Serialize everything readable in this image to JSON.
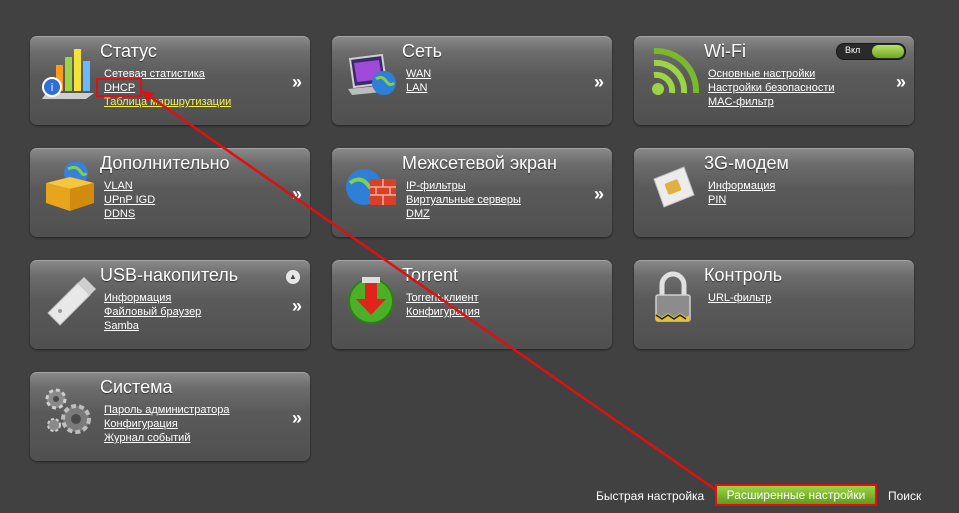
{
  "tiles": [
    {
      "id": "status",
      "title": "Статус",
      "icon": "chart-icon",
      "links": [
        "Сетевая статистика",
        "DHCP",
        "Таблица маршрутизации"
      ]
    },
    {
      "id": "net",
      "title": "Сеть",
      "icon": "network-monitor-icon",
      "links": [
        "WAN",
        "LAN"
      ]
    },
    {
      "id": "wifi",
      "title": "Wi-Fi",
      "icon": "wifi-icon",
      "links": [
        "Основные настройки",
        "Настройки безопасности",
        "MAC-фильтр"
      ],
      "toggle": "Вкл"
    },
    {
      "id": "extra",
      "title": "Дополнительно",
      "icon": "box-icon",
      "links": [
        "VLAN",
        "UPnP IGD",
        "DDNS"
      ]
    },
    {
      "id": "firewall",
      "title": "Межсетевой экран",
      "icon": "firewall-icon",
      "links": [
        "IP-фильтры",
        "Виртуальные серверы",
        "DMZ"
      ]
    },
    {
      "id": "modem",
      "title": "3G-модем",
      "icon": "sim-card-icon",
      "links": [
        "Информация",
        "PIN"
      ]
    },
    {
      "id": "usb",
      "title": "USB-накопитель",
      "icon": "usb-drive-icon",
      "links": [
        "Информация",
        "Файловый браузер",
        "Samba"
      ]
    },
    {
      "id": "torrent",
      "title": "Torrent",
      "icon": "download-icon",
      "links": [
        "Torrent-клиент",
        "Конфигурация"
      ]
    },
    {
      "id": "control",
      "title": "Контроль",
      "icon": "lock-icon",
      "links": [
        "URL-фильтр"
      ]
    },
    {
      "id": "system",
      "title": "Система",
      "icon": "gears-icon",
      "links": [
        "Пароль администратора",
        "Конфигурация",
        "Журнал событий"
      ]
    }
  ],
  "chevron": "»",
  "bottom": {
    "quick": "Быстрая настройка",
    "advanced": "Расширенные настройки",
    "search": "Поиск"
  },
  "colors": {
    "background": "#414141",
    "annotation": "#e01010",
    "accent_green": "#7ab82c"
  }
}
